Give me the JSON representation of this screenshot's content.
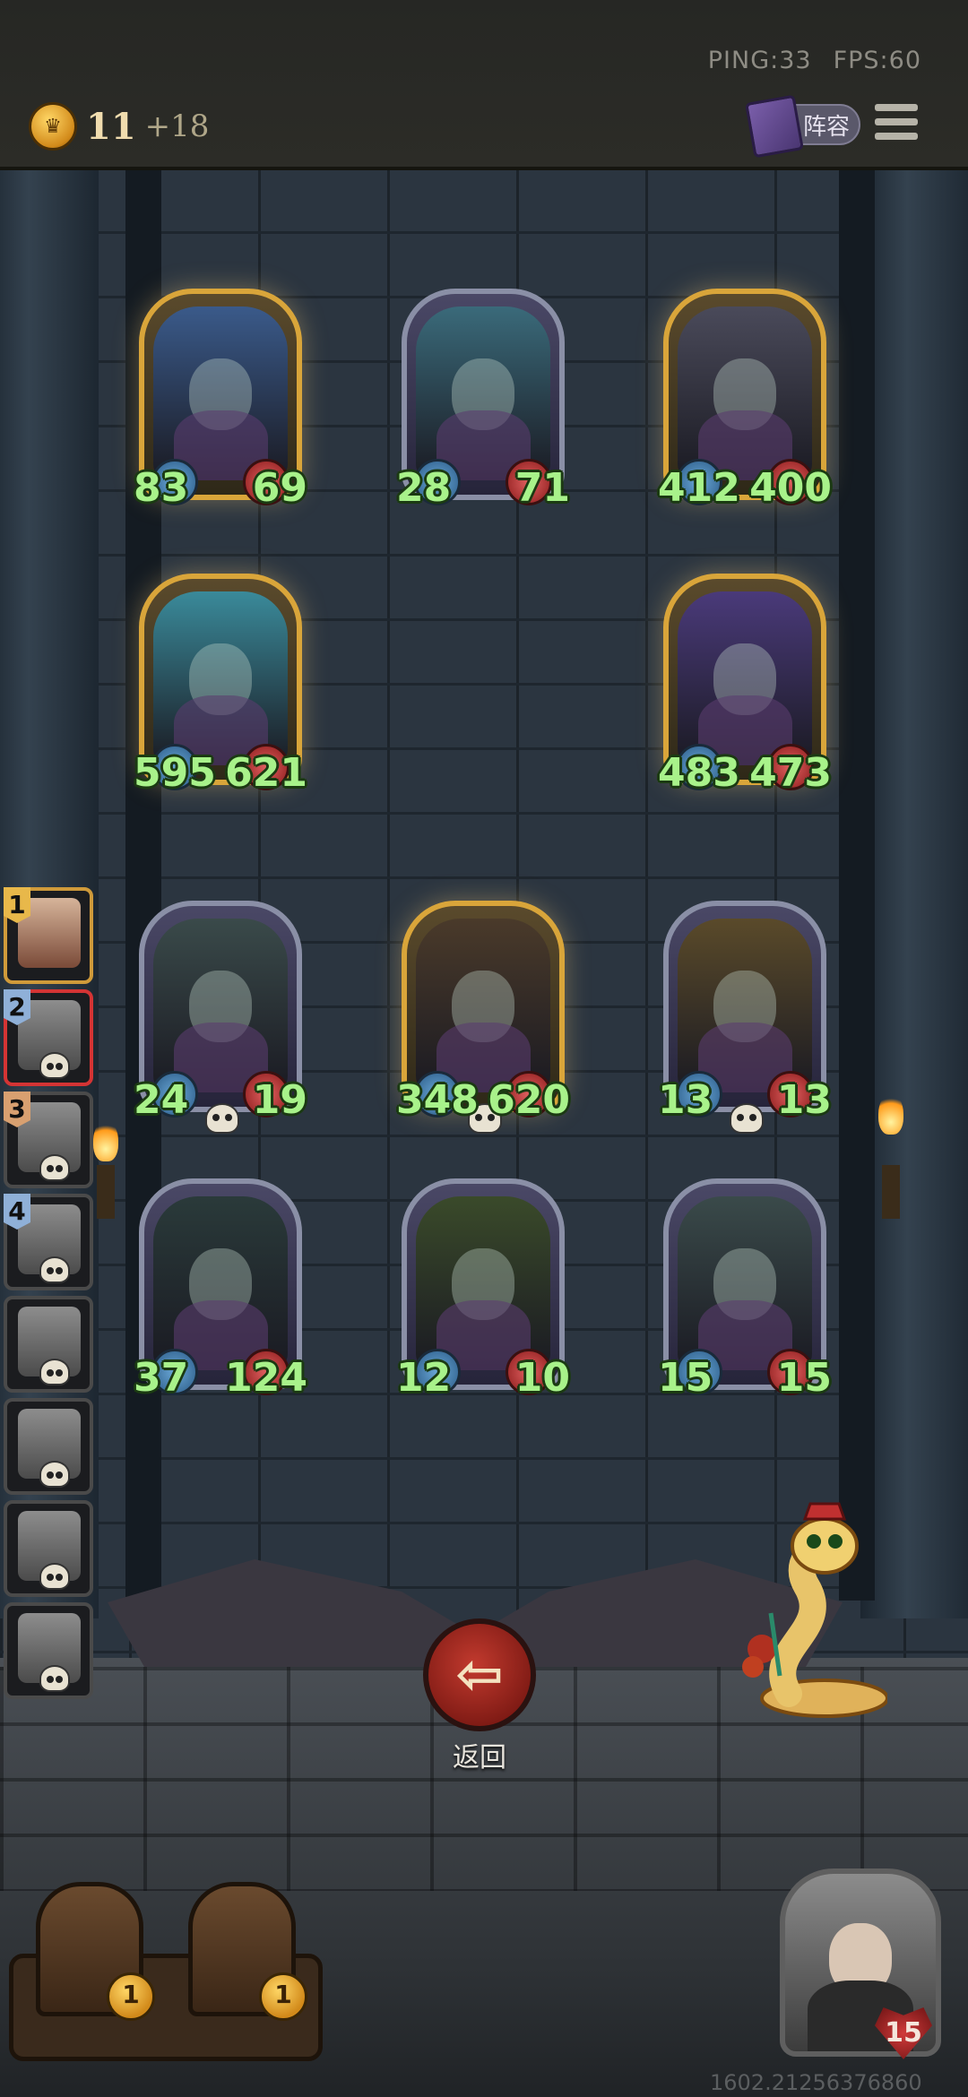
{
  "status": {
    "ping": "PING:33",
    "fps": "FPS:60"
  },
  "gold": {
    "amount": "11",
    "income": "+18"
  },
  "header": {
    "lineup_label": "阵容"
  },
  "board": {
    "enemy_row1": [
      {
        "atk": "83",
        "hp": "69",
        "frame": "gold",
        "theme": "#3a5a8a"
      },
      {
        "atk": "28",
        "hp": "71",
        "frame": "silver",
        "theme": "#3a6a7a"
      },
      {
        "atk": "412",
        "hp": "400",
        "frame": "gold",
        "theme": "#4a4a5a"
      }
    ],
    "enemy_row2": [
      {
        "atk": "595",
        "hp": "621",
        "frame": "gold",
        "theme": "#3a8a9a"
      },
      {
        "atk": "483",
        "hp": "473",
        "frame": "gold",
        "theme": "#4a3a7a"
      }
    ],
    "player_row1": [
      {
        "atk": "24",
        "hp": "19",
        "frame": "silver",
        "theme": "#3a4a4a"
      },
      {
        "atk": "348",
        "hp": "620",
        "frame": "gold",
        "theme": "#4a3a2a"
      },
      {
        "atk": "13",
        "hp": "13",
        "frame": "silver",
        "theme": "#5a4a2a"
      }
    ],
    "player_row2": [
      {
        "atk": "37",
        "hp": "124",
        "frame": "silver",
        "theme": "#2a3a3a"
      },
      {
        "atk": "12",
        "hp": "10",
        "frame": "silver",
        "theme": "#3a4a2a"
      },
      {
        "atk": "15",
        "hp": "15",
        "frame": "silver",
        "theme": "#3a4a4a"
      }
    ]
  },
  "roster": [
    {
      "num": "1",
      "badge_color": "#e8b84a"
    },
    {
      "num": "2",
      "badge_color": "#8fb0d8"
    },
    {
      "num": "3",
      "badge_color": "#d8a070"
    },
    {
      "num": "4",
      "badge_color": "#8fb0d8"
    },
    {
      "num": ""
    },
    {
      "num": ""
    },
    {
      "num": ""
    },
    {
      "num": ""
    }
  ],
  "back": {
    "label": "返回",
    "arrow": "⇦"
  },
  "chests": [
    {
      "count": "1"
    },
    {
      "count": "1"
    }
  ],
  "hero": {
    "hp": "15"
  },
  "debug": {
    "coords": "1602.21256376860"
  },
  "colors": {
    "stat_green": "#a8f28a",
    "gold_frame": "#d9a53a",
    "silver_frame": "#8a8fa6",
    "back_red": "#c23a2e"
  }
}
